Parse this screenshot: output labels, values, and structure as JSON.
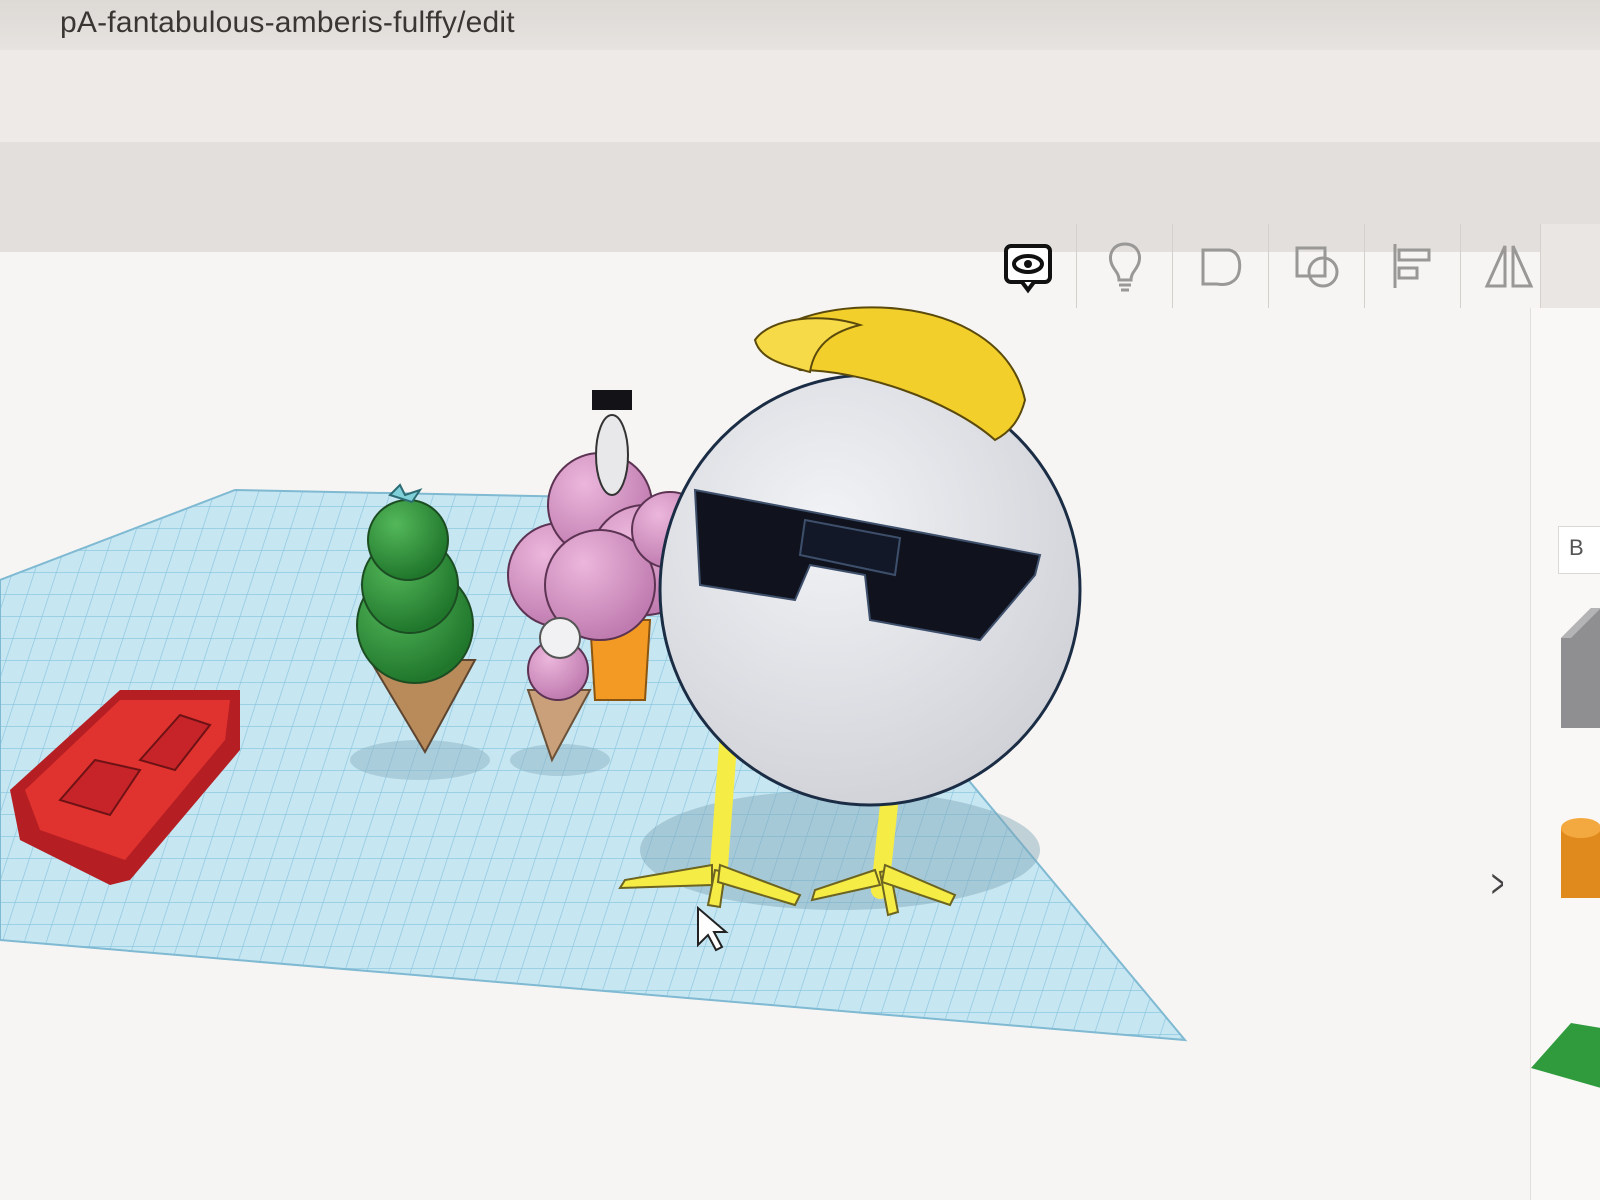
{
  "browser": {
    "url_fragment": "pA-fantabulous-amberis-fulffy/edit"
  },
  "toolbar": {
    "tools": [
      {
        "name": "show-all-icon"
      },
      {
        "name": "lightbulb-icon"
      },
      {
        "name": "group-icon"
      },
      {
        "name": "ungroup-icon"
      },
      {
        "name": "align-icon"
      },
      {
        "name": "mirror-icon"
      }
    ]
  },
  "right_panel": {
    "label": "B"
  },
  "workplane": {
    "objects": [
      "name-text-3d",
      "green-ice-cream-cone",
      "pink-ice-cream-cup",
      "small-ice-cream-cone",
      "egg-chick-with-cap-and-sunglasses"
    ]
  },
  "colors": {
    "grid": "#bfe3f0",
    "grid_line": "#89c4dc",
    "cap": "#f2cf2a",
    "egg": "#e7e8ec",
    "glasses": "#10131e",
    "feet": "#f5ec46",
    "text_3d": "#d92a2a",
    "green_scoop": "#2f9a3b",
    "pink_scoop": "#d99ac9",
    "cone": "#b98a5a",
    "cup": "#f39a25"
  }
}
